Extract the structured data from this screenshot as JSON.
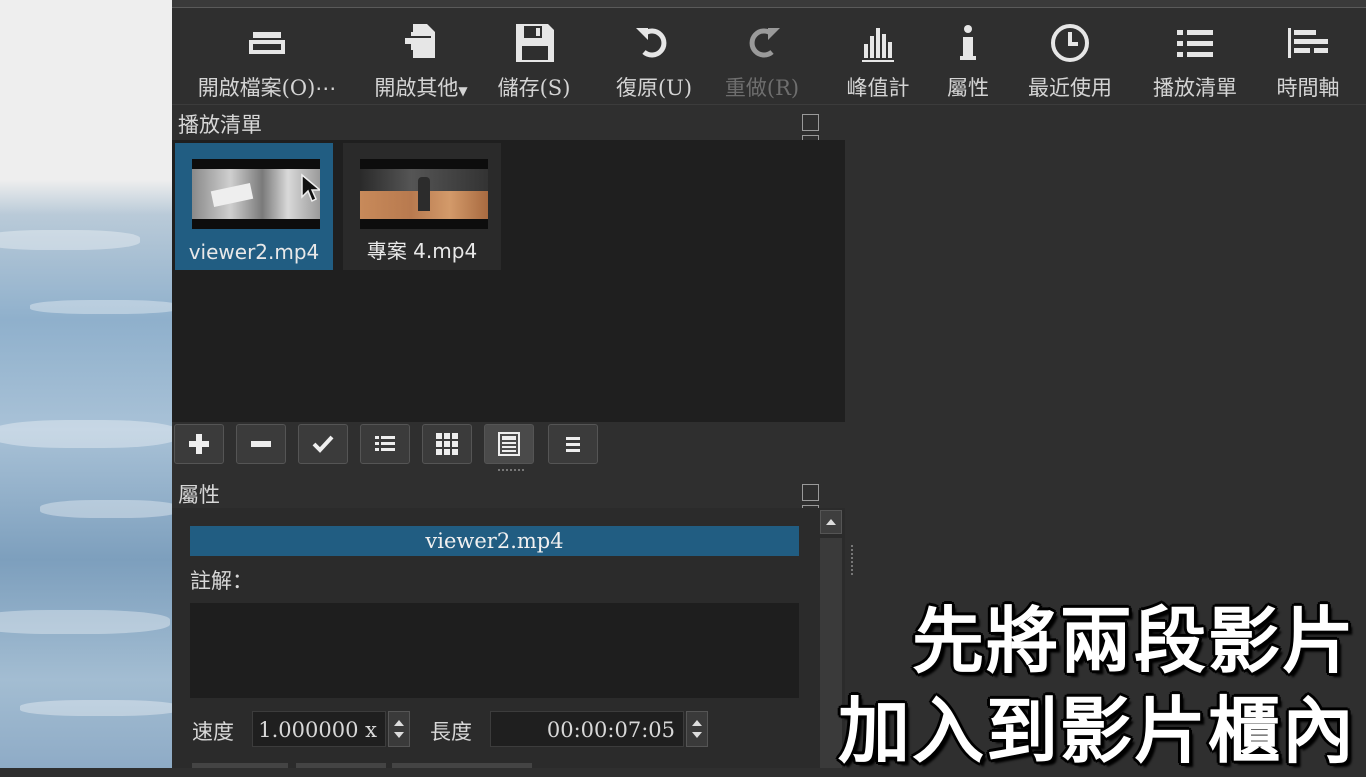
{
  "toolbar": {
    "items": [
      {
        "label": "開啟檔案(O)⋯",
        "icon": "folder-open-icon"
      },
      {
        "label": "開啟其他",
        "icon": "add-file-icon"
      },
      {
        "label": "儲存(S)",
        "icon": "save-icon"
      },
      {
        "label": "復原(U)",
        "icon": "undo-icon"
      },
      {
        "label": "重做(R)",
        "icon": "redo-icon",
        "disabled": true
      },
      {
        "label": "峰值計",
        "icon": "peak-meter-icon"
      },
      {
        "label": "屬性",
        "icon": "info-icon"
      },
      {
        "label": "最近使用",
        "icon": "clock-icon"
      },
      {
        "label": "播放清單",
        "icon": "list-icon"
      },
      {
        "label": "時間軸",
        "icon": "timeline-icon"
      }
    ]
  },
  "playlist": {
    "title": "播放清單",
    "clips": [
      {
        "name": "viewer2.mp4",
        "selected": true
      },
      {
        "name": "專案 4.mp4",
        "selected": false
      }
    ],
    "buttons": [
      "add-icon",
      "remove-icon",
      "check-icon",
      "details-view-icon",
      "tiles-view-icon",
      "icons-view-icon",
      "menu-icon"
    ]
  },
  "properties": {
    "title": "屬性",
    "file_name": "viewer2.mp4",
    "note_label": "註解：",
    "speed_label": "速度",
    "speed_value": "1.000000 x",
    "length_label": "長度",
    "length_value": "00:00:07:05"
  },
  "caption": {
    "line1": "先將兩段影片",
    "line2": "加入到影片櫃內"
  },
  "colors": {
    "selection": "#215d82",
    "background": "#2f2f2f",
    "panel": "#1f1f1f"
  }
}
